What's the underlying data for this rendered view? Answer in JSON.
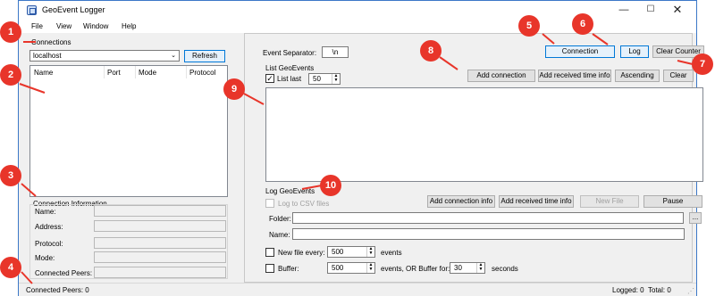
{
  "window": {
    "title": "GeoEvent Logger",
    "controls": {
      "minimize": "—",
      "maximize": "☐",
      "close": "✕"
    }
  },
  "menu": [
    "File",
    "View",
    "Window",
    "Help"
  ],
  "connections": {
    "group_label": "Connections",
    "host_value": "localhost",
    "refresh_label": "Refresh",
    "columns": [
      "Name",
      "Port",
      "Mode",
      "Protocol"
    ]
  },
  "connection_info": {
    "group_label": "Connection Information",
    "fields": [
      "Name:",
      "Address:",
      "Protocol:",
      "Mode:",
      "Connected Peers:"
    ]
  },
  "toolbar": {
    "event_separator_label": "Event Separator:",
    "event_separator_value": "\\n",
    "connection_label": "Connection",
    "log_label": "Log",
    "clear_counter_label": "Clear Counter"
  },
  "list_geoevents": {
    "group_label": "List GeoEvents",
    "list_last_label": "List last",
    "list_last_checked": true,
    "list_last_value": "50",
    "add_connection_label": "Add connection",
    "add_received_time_label": "Add received time info",
    "ascending_label": "Ascending",
    "clear_label": "Clear"
  },
  "log_geoevents": {
    "group_label": "Log GeoEvents",
    "log_to_csv_label": "Log to CSV files",
    "add_connection_info_label": "Add connection info",
    "add_received_time_info_label": "Add received time info",
    "new_file_label": "New File",
    "pause_label": "Pause",
    "folder_label": "Folder:",
    "folder_value": "",
    "browse_label": "...",
    "name_label": "Name:",
    "name_value": "",
    "new_file_every_label": "New file every:",
    "new_file_every_value": "500",
    "events_label": "events",
    "buffer_label": "Buffer:",
    "buffer_value": "500",
    "buffer_for_label": "events, OR Buffer for:",
    "buffer_for_value": "30",
    "seconds_label": "seconds"
  },
  "status": {
    "connected_peers": "Connected Peers: 0",
    "logged": "Logged: 0",
    "total": "Total: 0"
  },
  "callouts": [
    "1",
    "2",
    "3",
    "4",
    "5",
    "6",
    "7",
    "8",
    "9",
    "10"
  ],
  "colors": {
    "callout": "#e8352a",
    "accent": "#0078d7"
  }
}
